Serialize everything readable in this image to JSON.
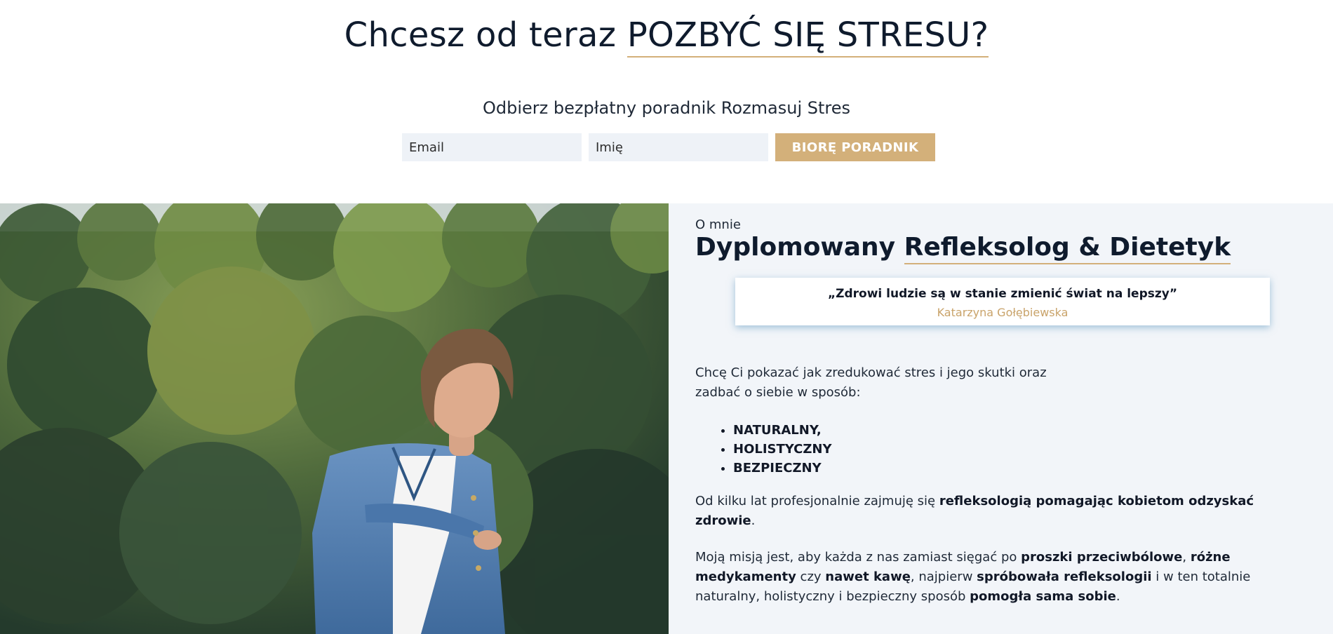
{
  "hero": {
    "headline_prefix": "Chcesz od teraz ",
    "headline_highlight": "POZBYĆ SIĘ STRESU?",
    "subheadline": "Odbierz bezpłatny poradnik Rozmasuj Stres",
    "form": {
      "email_placeholder": "Email",
      "name_placeholder": "Imię",
      "submit_label": "BIORĘ PORADNIK"
    }
  },
  "about": {
    "eyebrow": "O mnie",
    "title_prefix": "Dyplomowany ",
    "title_highlight": "Refleksolog & Dietetyk",
    "quote": {
      "text": "„Zdrowi ludzie są w stanie zmienić świat na lepszy”",
      "author": "Katarzyna Gołębiewska"
    },
    "intro": "Chcę Ci pokazać jak zredukować stres i jego skutki oraz zadbać o siebie w sposób:",
    "qualities": [
      "NATURALNY,",
      "HOLISTYCZNY",
      "BEZPIECZNY"
    ],
    "paragraph2": {
      "t1": "Od kilku lat profesjonalnie zajmuję się ",
      "b1": "refleksologią pomagając kobietom odzyskać zdrowie",
      "t2": "."
    },
    "paragraph3": {
      "t1": "Moją misją jest, aby każda z nas zamiast sięgać po ",
      "b1": "proszki przeciwbólowe",
      "t2": ", ",
      "b2": "różne medykamenty",
      "t3": " czy ",
      "b3": "nawet kawę",
      "t4": ", najpierw ",
      "b4": "spróbowała refleksologii",
      "t5": " i w ten totalnie naturalny, holistyczny i bezpieczny sposób ",
      "b5": "pomogła sama sobie",
      "t6": "."
    }
  },
  "colors": {
    "accent_gold": "#d3b07a",
    "heading_navy": "#0f1b2d",
    "section_bg": "#f2f5f9",
    "input_bg": "#eef2f7"
  }
}
